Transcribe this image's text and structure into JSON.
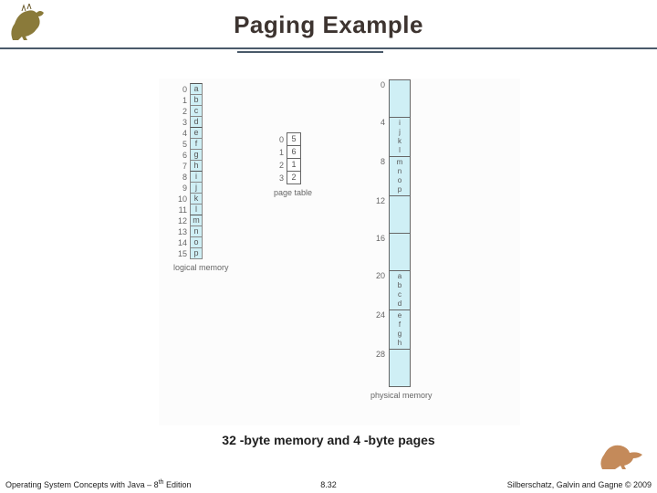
{
  "title": "Paging Example",
  "caption": "32 -byte memory and 4 -byte pages",
  "footer": {
    "left": "Operating System Concepts with Java – 8",
    "left_sup": "th",
    "left_tail": " Edition",
    "center": "8.32",
    "right": "Silberschatz, Galvin and Gagne © 2009"
  },
  "logical_label": "logical memory",
  "page_table_label": "page table",
  "physical_label": "physical memory",
  "logical": [
    {
      "i": "0",
      "v": "a"
    },
    {
      "i": "1",
      "v": "b"
    },
    {
      "i": "2",
      "v": "c"
    },
    {
      "i": "3",
      "v": "d"
    },
    {
      "i": "4",
      "v": "e"
    },
    {
      "i": "5",
      "v": "f"
    },
    {
      "i": "6",
      "v": "g"
    },
    {
      "i": "7",
      "v": "h"
    },
    {
      "i": "8",
      "v": "i"
    },
    {
      "i": "9",
      "v": "j"
    },
    {
      "i": "10",
      "v": "k"
    },
    {
      "i": "11",
      "v": "l"
    },
    {
      "i": "12",
      "v": "m"
    },
    {
      "i": "13",
      "v": "n"
    },
    {
      "i": "14",
      "v": "o"
    },
    {
      "i": "15",
      "v": "p"
    }
  ],
  "page_table": [
    {
      "i": "0",
      "v": "5"
    },
    {
      "i": "1",
      "v": "6"
    },
    {
      "i": "2",
      "v": "1"
    },
    {
      "i": "3",
      "v": "2"
    }
  ],
  "physical": [
    {
      "i": "0",
      "cells": [
        "",
        "",
        "",
        ""
      ]
    },
    {
      "i": "4",
      "cells": [
        "i",
        "j",
        "k",
        "l"
      ]
    },
    {
      "i": "8",
      "cells": [
        "m",
        "n",
        "o",
        "p"
      ]
    },
    {
      "i": "12",
      "cells": [
        "",
        "",
        "",
        ""
      ]
    },
    {
      "i": "16",
      "cells": [
        "",
        "",
        "",
        ""
      ]
    },
    {
      "i": "20",
      "cells": [
        "a",
        "b",
        "c",
        "d"
      ]
    },
    {
      "i": "24",
      "cells": [
        "e",
        "f",
        "g",
        "h"
      ]
    },
    {
      "i": "28",
      "cells": [
        "",
        "",
        "",
        ""
      ]
    }
  ]
}
